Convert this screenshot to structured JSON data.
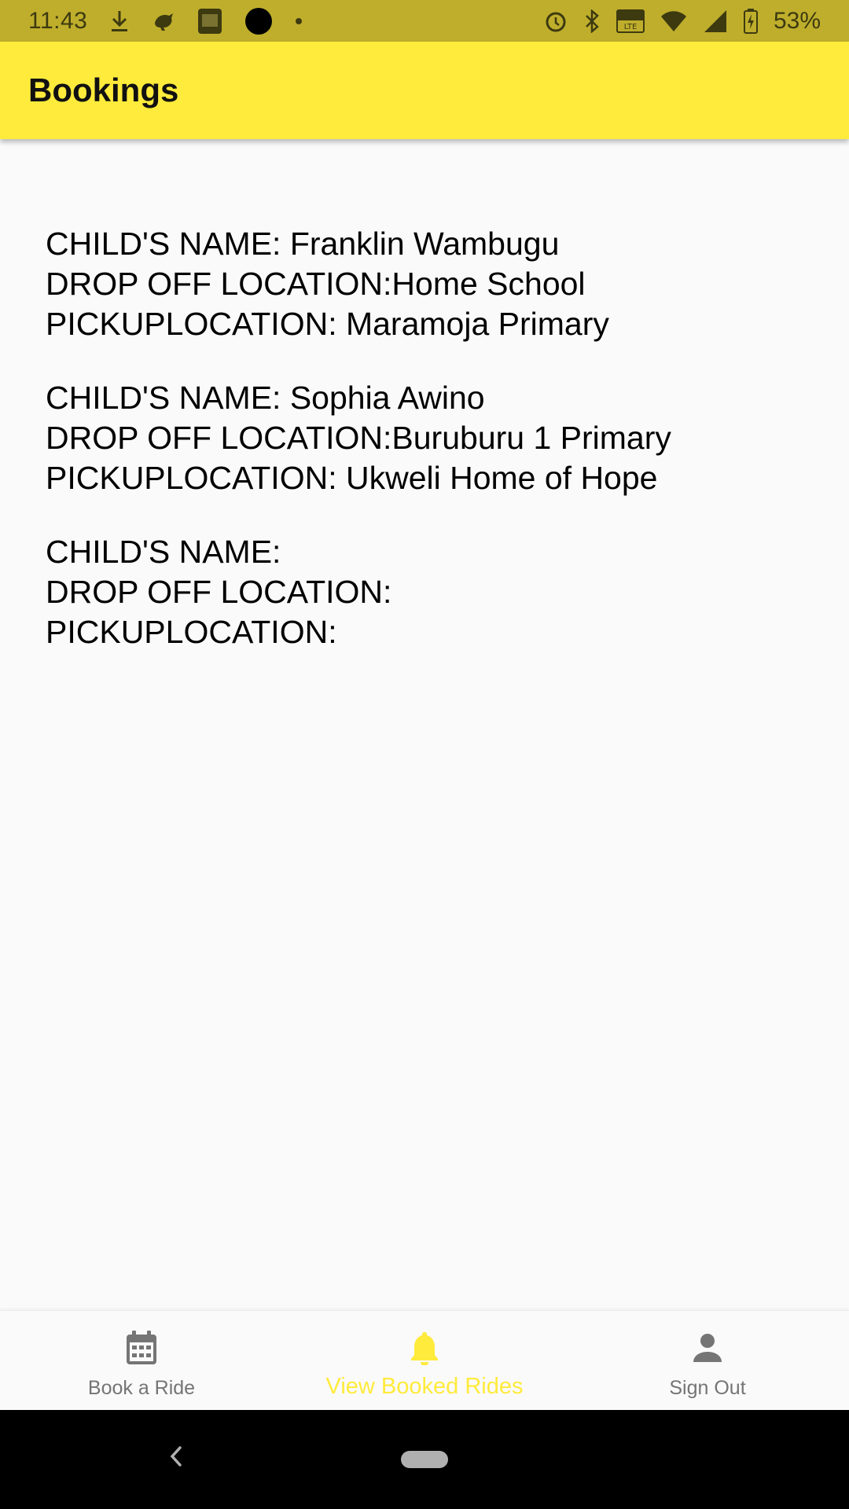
{
  "status_bar": {
    "time": "11:43",
    "battery": "53%",
    "left_icons": [
      "download-icon",
      "bird-icon",
      "bible-app-icon",
      "circle-notification-icon",
      "dot-icon"
    ],
    "right_icons": [
      "alarm-icon",
      "bluetooth-icon",
      "volte-icon",
      "wifi-icon",
      "signal-icon",
      "battery-charging-icon"
    ]
  },
  "app_bar": {
    "title": "Bookings"
  },
  "bookings": [
    {
      "child": "CHILD'S NAME: Franklin Wambugu",
      "dropoff": "DROP OFF LOCATION:Home School",
      "pickup": "PICKUPLOCATION: Maramoja Primary"
    },
    {
      "child": "CHILD'S NAME: Sophia Awino",
      "dropoff": "DROP OFF LOCATION:Buruburu 1 Primary",
      "pickup": "PICKUPLOCATION: Ukweli Home of Hope"
    },
    {
      "child": "CHILD'S NAME:",
      "dropoff": "DROP OFF LOCATION:",
      "pickup": "PICKUPLOCATION:"
    }
  ],
  "bottom_nav": {
    "items": [
      {
        "label": "Book a Ride",
        "icon": "calendar-icon",
        "active": false
      },
      {
        "label": "View Booked Rides",
        "icon": "bell-icon",
        "active": true
      },
      {
        "label": "Sign Out",
        "icon": "person-icon",
        "active": false
      }
    ]
  },
  "colors": {
    "status_bar": "#bfae2c",
    "app_bar": "#ffeb3b",
    "active_nav": "#ffeb3b",
    "inactive_nav": "#757575"
  }
}
